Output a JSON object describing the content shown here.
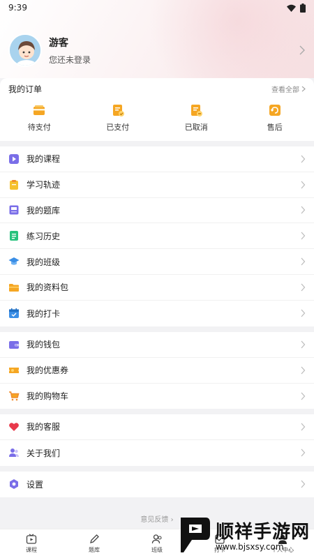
{
  "status": {
    "time": "9:39"
  },
  "profile": {
    "name": "游客",
    "subtitle": "您还未登录"
  },
  "orders": {
    "title": "我的订单",
    "view_all": "查看全部",
    "items": [
      {
        "label": "待支付",
        "icon": "wallet-card-icon"
      },
      {
        "label": "已支付",
        "icon": "paid-doc-icon"
      },
      {
        "label": "已取消",
        "icon": "cancelled-doc-icon"
      },
      {
        "label": "售后",
        "icon": "after-sale-icon"
      }
    ]
  },
  "menu_group1": [
    {
      "label": "我的课程",
      "icon": "play-course-icon"
    },
    {
      "label": "学习轨迹",
      "icon": "clipboard-icon"
    },
    {
      "label": "我的题库",
      "icon": "question-bank-icon"
    },
    {
      "label": "练习历史",
      "icon": "history-doc-icon"
    },
    {
      "label": "我的班级",
      "icon": "graduation-cap-icon"
    },
    {
      "label": "我的资料包",
      "icon": "folder-icon"
    },
    {
      "label": "我的打卡",
      "icon": "calendar-check-icon"
    }
  ],
  "menu_group2": [
    {
      "label": "我的钱包",
      "icon": "wallet-icon"
    },
    {
      "label": "我的优惠券",
      "icon": "coupon-icon"
    },
    {
      "label": "我的购物车",
      "icon": "cart-icon"
    }
  ],
  "menu_group3": [
    {
      "label": "我的客服",
      "icon": "heart-icon"
    },
    {
      "label": "关于我们",
      "icon": "users-icon"
    }
  ],
  "menu_group4": [
    {
      "label": "设置",
      "icon": "settings-hex-icon"
    }
  ],
  "feedback": "意见反馈",
  "tabs": [
    {
      "label": "课程",
      "icon": "course-tab-icon"
    },
    {
      "label": "题库",
      "icon": "pen-tab-icon"
    },
    {
      "label": "班级",
      "icon": "class-tab-icon"
    },
    {
      "label": "打卡",
      "icon": "checkin-tab-icon"
    },
    {
      "label": "个人中心",
      "icon": "profile-tab-icon"
    }
  ],
  "watermark": {
    "title": "顺祥手游网",
    "url": "www.bjsxsy.com"
  },
  "colors": {
    "accent": "#f5a623",
    "heart": "#e8394b",
    "purple": "#7a6ee8",
    "green": "#27c27d",
    "blue": "#3a8ee6"
  }
}
